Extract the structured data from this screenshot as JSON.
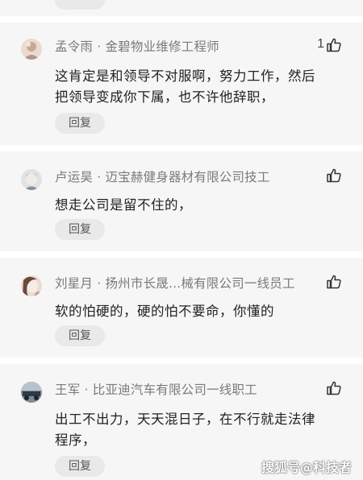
{
  "comments": [
    {
      "author": "孟令雨 · 金碧物业维修工程师",
      "likes": "1",
      "lines": [
        "这肯定是和领导不对服啊，努力工作，然后",
        "把领导变成你下属，也不许他辞职，"
      ],
      "reply_label": "回复"
    },
    {
      "author": "卢运昊 · 迈宝赫健身器材有限公司技工",
      "likes": "",
      "lines": [
        "想走公司是留不住的，"
      ],
      "reply_label": "回复"
    },
    {
      "author": "刘星月 · 扬州市长晟...械有限公司一线员工",
      "likes": "",
      "lines": [
        "软的怕硬的，硬的怕不要命，你懂的"
      ],
      "reply_label": "回复"
    },
    {
      "author": "王军 · 比亚迪汽车有限公司一线职工",
      "likes": "",
      "lines": [
        "出工不出力，天天混日子，在不行就走法律",
        "程序，"
      ],
      "reply_label": "回复"
    }
  ],
  "watermark": "搜狐号@科技者",
  "colors": {
    "card_bg": "#f6f6f6",
    "pill_bg": "#e9e9e9",
    "meta_text": "#7a7a7a",
    "body_text": "#222222"
  },
  "icons": {
    "like": "thumbs-up-icon",
    "avatar": "user-avatar"
  }
}
